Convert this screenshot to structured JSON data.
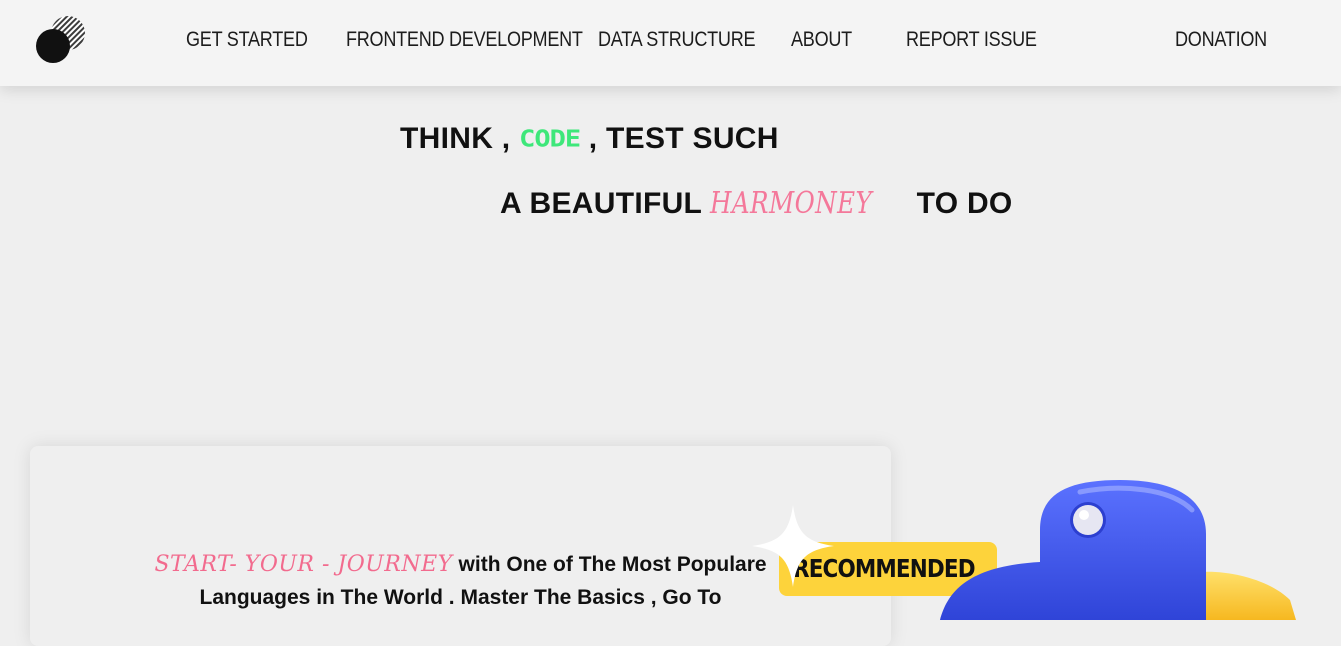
{
  "nav": {
    "links": [
      "GET STARTED",
      "FRONTEND DEVELOPMENT",
      "DATA STRUCTURE",
      "ABOUT",
      "REPORT ISSUE"
    ],
    "donation": "DONATION"
  },
  "hero": {
    "line1_pre": "THINK ,",
    "line1_code": "CODE",
    "line1_post": ", TEST SUCH",
    "line2_pre": "A BEAUTIFUL",
    "line2_script": "HARMONEY",
    "line2_post": "TO DO"
  },
  "card": {
    "journey": "START- YOUR - JOURNEY",
    "text_line1": "with One of The Most Populare",
    "text_line2": "Languages in The World . Master The Basics , Go To"
  },
  "badge": {
    "label": "RECOMMENDED"
  },
  "icons": {
    "logo": "moon-logo-icon",
    "sparkle": "sparkle-icon",
    "python": "python-logo-icon"
  },
  "colors": {
    "background": "#efefef",
    "code_green": "#3ee77a",
    "script_pink": "#f4789a",
    "badge_yellow": "#fdd33b",
    "python_blue": "#3d55e6",
    "python_yellow": "#ffcf3a"
  }
}
